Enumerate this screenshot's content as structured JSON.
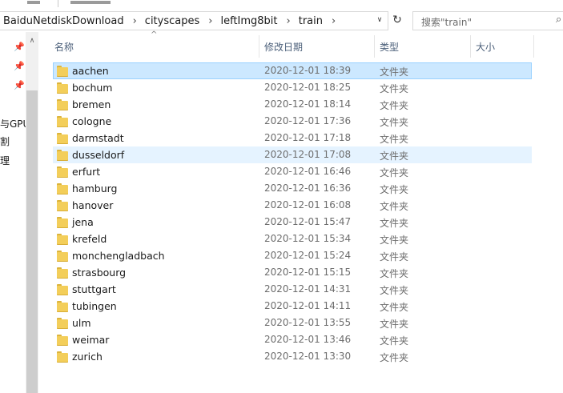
{
  "address_bar": {
    "breadcrumbs": [
      "BaiduNetdiskDownload",
      "cityscapes",
      "leftImg8bit",
      "train"
    ],
    "separator": "›",
    "dropdown_icon": "chevron-down-icon",
    "dropdown_glyph": "∨",
    "refresh_icon": "refresh-icon",
    "refresh_glyph": "↻"
  },
  "search": {
    "placeholder": "搜索\"train\"",
    "icon": "search-icon",
    "icon_glyph": "⌕"
  },
  "nav_pane": {
    "pin_glyph": "📌",
    "scroll_up_glyph": "∧",
    "labels": [
      "与GPU",
      "割",
      "理"
    ]
  },
  "columns": {
    "name": "名称",
    "date": "修改日期",
    "type": "类型",
    "size": "大小",
    "sort_glyph": "^"
  },
  "files": [
    {
      "name": "aachen",
      "date": "2020-12-01 18:39",
      "type": "文件夹",
      "size": "",
      "state": "selected"
    },
    {
      "name": "bochum",
      "date": "2020-12-01 18:25",
      "type": "文件夹",
      "size": "",
      "state": ""
    },
    {
      "name": "bremen",
      "date": "2020-12-01 18:14",
      "type": "文件夹",
      "size": "",
      "state": ""
    },
    {
      "name": "cologne",
      "date": "2020-12-01 17:36",
      "type": "文件夹",
      "size": "",
      "state": ""
    },
    {
      "name": "darmstadt",
      "date": "2020-12-01 17:18",
      "type": "文件夹",
      "size": "",
      "state": ""
    },
    {
      "name": "dusseldorf",
      "date": "2020-12-01 17:08",
      "type": "文件夹",
      "size": "",
      "state": "hover"
    },
    {
      "name": "erfurt",
      "date": "2020-12-01 16:46",
      "type": "文件夹",
      "size": "",
      "state": ""
    },
    {
      "name": "hamburg",
      "date": "2020-12-01 16:36",
      "type": "文件夹",
      "size": "",
      "state": ""
    },
    {
      "name": "hanover",
      "date": "2020-12-01 16:08",
      "type": "文件夹",
      "size": "",
      "state": ""
    },
    {
      "name": "jena",
      "date": "2020-12-01 15:47",
      "type": "文件夹",
      "size": "",
      "state": ""
    },
    {
      "name": "krefeld",
      "date": "2020-12-01 15:34",
      "type": "文件夹",
      "size": "",
      "state": ""
    },
    {
      "name": "monchengladbach",
      "date": "2020-12-01 15:24",
      "type": "文件夹",
      "size": "",
      "state": ""
    },
    {
      "name": "strasbourg",
      "date": "2020-12-01 15:15",
      "type": "文件夹",
      "size": "",
      "state": ""
    },
    {
      "name": "stuttgart",
      "date": "2020-12-01 14:31",
      "type": "文件夹",
      "size": "",
      "state": ""
    },
    {
      "name": "tubingen",
      "date": "2020-12-01 14:11",
      "type": "文件夹",
      "size": "",
      "state": ""
    },
    {
      "name": "ulm",
      "date": "2020-12-01 13:55",
      "type": "文件夹",
      "size": "",
      "state": ""
    },
    {
      "name": "weimar",
      "date": "2020-12-01 13:46",
      "type": "文件夹",
      "size": "",
      "state": ""
    },
    {
      "name": "zurich",
      "date": "2020-12-01 13:30",
      "type": "文件夹",
      "size": "",
      "state": ""
    }
  ],
  "colors": {
    "selected_bg": "#cce8ff",
    "hover_bg": "#e5f3ff",
    "folder": "#f3ce5a"
  }
}
